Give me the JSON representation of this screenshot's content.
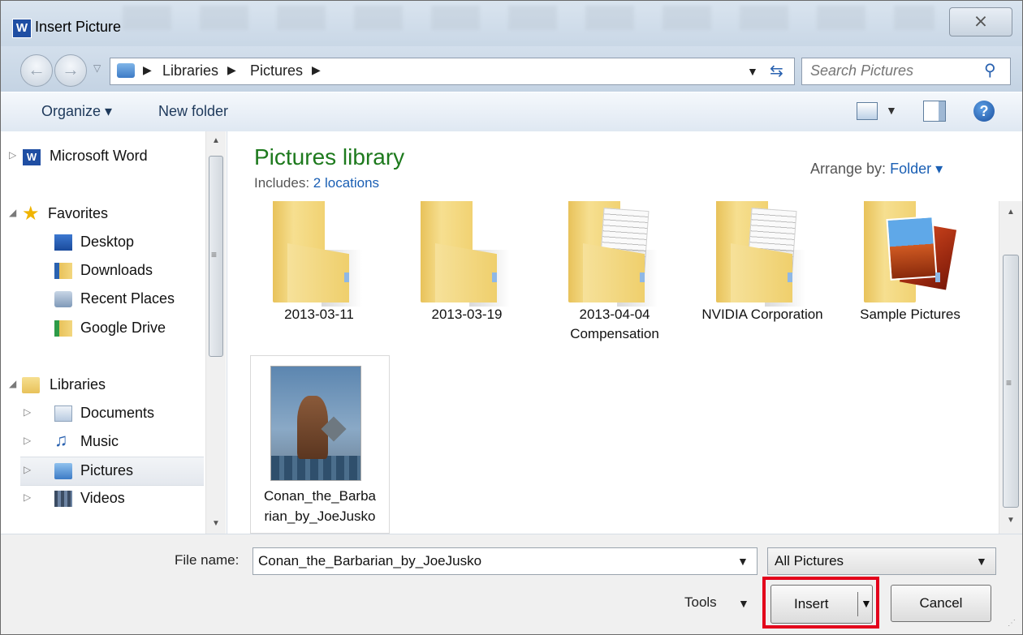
{
  "window": {
    "title": "Insert Picture",
    "app_icon_letter": "W",
    "close_glyph": "⨯"
  },
  "address": {
    "crumbs": [
      "Libraries",
      "Pictures"
    ],
    "search_placeholder": "Search Pictures"
  },
  "toolbar": {
    "organize_label": "Organize ▾",
    "new_folder_label": "New folder"
  },
  "nav": {
    "items": [
      {
        "label": "Microsoft Word",
        "icon": "word-icon"
      },
      {
        "label": "Favorites",
        "icon": "star-icon"
      },
      {
        "label": "Desktop",
        "icon": "desktop-icon"
      },
      {
        "label": "Downloads",
        "icon": "downloads-folder-icon"
      },
      {
        "label": "Recent Places",
        "icon": "recent-places-icon"
      },
      {
        "label": "Google Drive",
        "icon": "google-drive-icon"
      },
      {
        "label": "Libraries",
        "icon": "libraries-icon"
      },
      {
        "label": "Documents",
        "icon": "documents-icon"
      },
      {
        "label": "Music",
        "icon": "music-icon"
      },
      {
        "label": "Pictures",
        "icon": "pictures-icon",
        "selected": true
      },
      {
        "label": "Videos",
        "icon": "videos-icon"
      }
    ]
  },
  "content": {
    "title": "Pictures library",
    "includes_label": "Includes:",
    "includes_link": "2 locations",
    "arrange_label": "Arrange by:",
    "arrange_value": "Folder ▾",
    "items": [
      {
        "label": "2013-03-11",
        "type": "folder"
      },
      {
        "label": "2013-03-19",
        "type": "folder"
      },
      {
        "label": "2013-04-04 Compensation",
        "type": "folder-doc"
      },
      {
        "label": "NVIDIA Corporation",
        "type": "folder-doc"
      },
      {
        "label": "Sample Pictures",
        "type": "folder-photo"
      },
      {
        "label": "Conan_the_Barba rian_by_JoeJusko",
        "type": "image"
      }
    ]
  },
  "bottom": {
    "file_name_label": "File name:",
    "file_name_value": "Conan_the_Barbarian_by_JoeJusko",
    "file_type_value": "All Pictures",
    "tools_label": "Tools",
    "insert_label": "Insert",
    "cancel_label": "Cancel"
  },
  "colors": {
    "highlight": "#e3001b",
    "library_title": "#1e7a1e",
    "link": "#1a5fb4"
  }
}
